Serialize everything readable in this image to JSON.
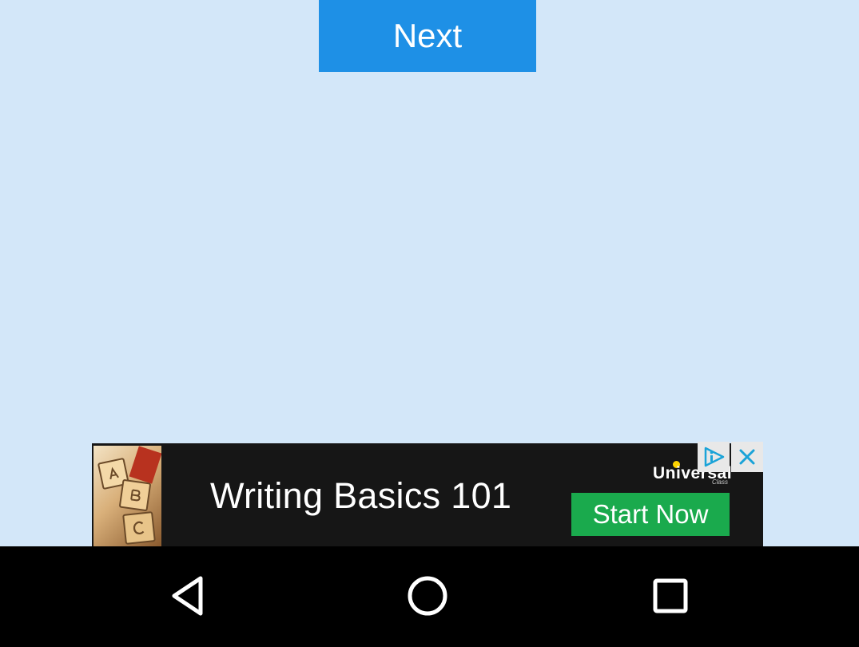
{
  "main": {
    "next_label": "Next"
  },
  "ad": {
    "title": "Writing Basics 101",
    "brand": "Universal",
    "brand_sub": "Class",
    "cta_label": "Start Now"
  },
  "icons": {
    "adchoices": "adchoices-icon",
    "close": "close-icon",
    "back": "back-icon",
    "home": "home-icon",
    "recents": "recents-icon"
  },
  "colors": {
    "background": "#d3e7f9",
    "next_button": "#1e90e6",
    "ad_background": "#161616",
    "cta": "#1aaa4d",
    "navbar": "#000000"
  }
}
